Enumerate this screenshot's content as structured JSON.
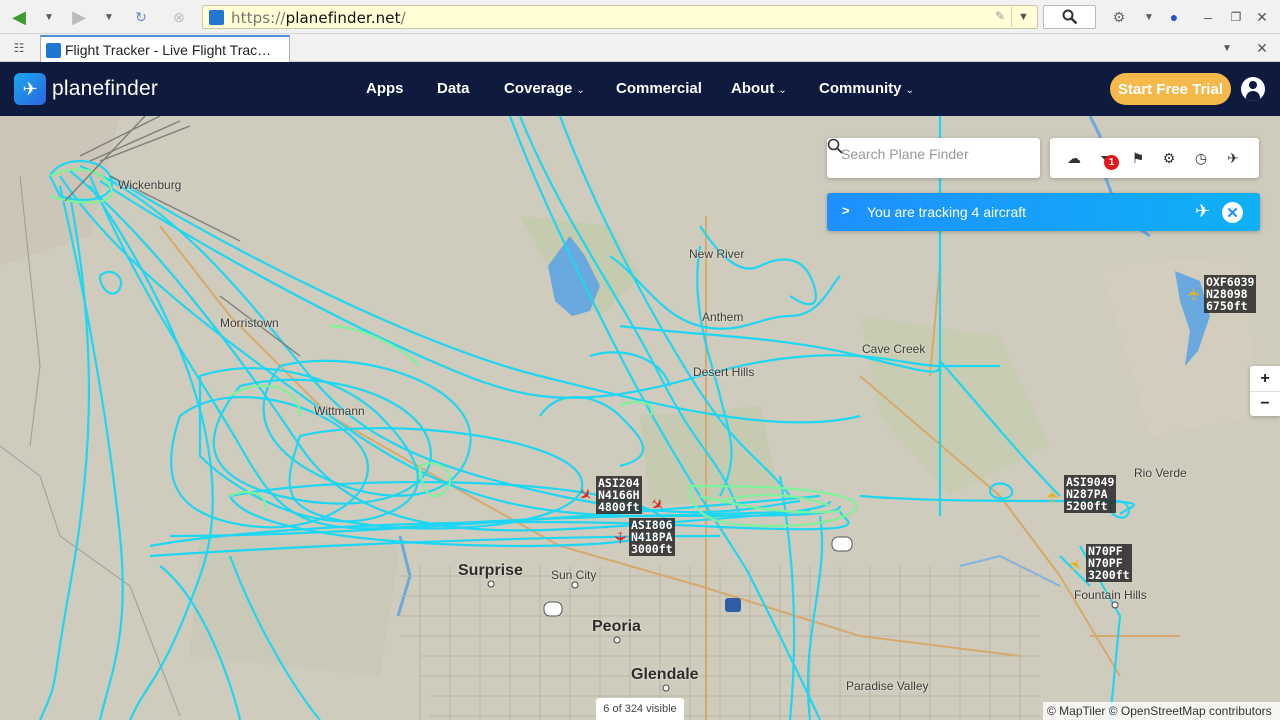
{
  "browser": {
    "url_scheme": "https://",
    "url_host": "planefinder.net",
    "url_path": "/",
    "tab_title": "Flight Tracker - Live Flight Trac…"
  },
  "header": {
    "logo_text": "planefinder",
    "nav": [
      {
        "label": "Apps",
        "has_dropdown": false
      },
      {
        "label": "Data",
        "has_dropdown": false
      },
      {
        "label": "Coverage",
        "has_dropdown": true
      },
      {
        "label": "Commercial",
        "has_dropdown": false
      },
      {
        "label": "About",
        "has_dropdown": true
      },
      {
        "label": "Community",
        "has_dropdown": true
      }
    ],
    "trial_button": "Start Free Trial"
  },
  "search": {
    "placeholder": "Search Plane Finder"
  },
  "tools": {
    "icons": [
      "cloud-upload-icon",
      "filter-icon",
      "bookmark-icon",
      "settings-icon",
      "history-icon",
      "aircraft-icon"
    ],
    "filter_badge": "1"
  },
  "tracking": {
    "text": "You are tracking 4 aircraft"
  },
  "zoom": {
    "in": "+",
    "out": "−"
  },
  "status": {
    "visible_count": "6 of 324 visible",
    "attribution": "© MapTiler © OpenStreetMap contributors"
  },
  "places": [
    {
      "name": "Wickenburg",
      "size": "small"
    },
    {
      "name": "Morristown",
      "size": "small"
    },
    {
      "name": "Wittmann",
      "size": "small"
    },
    {
      "name": "New River",
      "size": "small"
    },
    {
      "name": "Anthem",
      "size": "small"
    },
    {
      "name": "Desert Hills",
      "size": "small"
    },
    {
      "name": "Cave Creek",
      "size": "small"
    },
    {
      "name": "Rio Verde",
      "size": "small"
    },
    {
      "name": "Fountain Hills",
      "size": "small"
    },
    {
      "name": "Sun City",
      "size": "small"
    },
    {
      "name": "Paradise Valley",
      "size": "small"
    },
    {
      "name": "Surprise",
      "size": "big"
    },
    {
      "name": "Peoria",
      "size": "big"
    },
    {
      "name": "Glendale",
      "size": "big"
    }
  ],
  "aircraft": [
    {
      "callsign": "ASI204",
      "reg": "N4166H",
      "alt": "4800ft",
      "color": "#d62a2a"
    },
    {
      "callsign": "ASI806",
      "reg": "N418PA",
      "alt": "3000ft",
      "color": "#d62a2a"
    },
    {
      "callsign": "ASI9049",
      "reg": "N287PA",
      "alt": "5200ft",
      "color": "#e9b21c"
    },
    {
      "callsign": "N70PF",
      "reg": "N70PF",
      "alt": "3200ft",
      "color": "#e9b21c"
    },
    {
      "callsign": "OXF6039",
      "reg": "N28098",
      "alt": "6750ft",
      "color": "#e9b21c"
    }
  ],
  "colors": {
    "header_bg": "#0e1a3e",
    "trial_bg": "#f5b84b",
    "track_cyan": "#1fd6f2",
    "track_green": "#7ef29a",
    "banner_blue": "#1e90ff"
  }
}
